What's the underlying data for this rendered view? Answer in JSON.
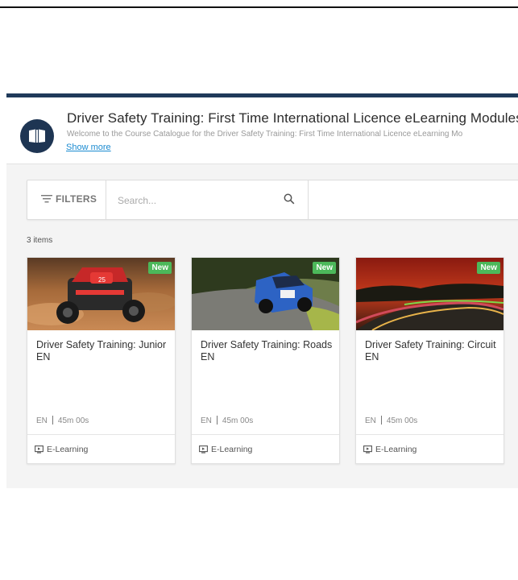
{
  "header": {
    "title": "Driver Safety Training: First Time International Licence eLearning Modules",
    "subtitle": "Welcome to the Course Catalogue for the Driver Safety Training: First Time International Licence eLearning Mo",
    "show_more": "Show more",
    "logo_icon": "book-open-icon"
  },
  "toolbar": {
    "filters_label": "FILTERS",
    "filters_icon": "filter-lines-icon",
    "search_placeholder": "Search...",
    "search_icon": "search-icon"
  },
  "results": {
    "count_label": "3 items"
  },
  "cards": [
    {
      "title": "Driver Safety Training: Junior EN",
      "badge": "New",
      "language": "EN",
      "duration": "45m 00s",
      "type": "E-Learning",
      "type_icon": "elearning-icon"
    },
    {
      "title": "Driver Safety Training: Roads EN",
      "badge": "New",
      "language": "EN",
      "duration": "45m 00s",
      "type": "E-Learning",
      "type_icon": "elearning-icon"
    },
    {
      "title": "Driver Safety Training: Circuit EN",
      "badge": "New",
      "language": "EN",
      "duration": "45m 00s",
      "type": "E-Learning",
      "type_icon": "elearning-icon"
    }
  ],
  "colors": {
    "brand": "#1e3553",
    "badge": "#4cb85a",
    "link": "#1b8bd1"
  }
}
